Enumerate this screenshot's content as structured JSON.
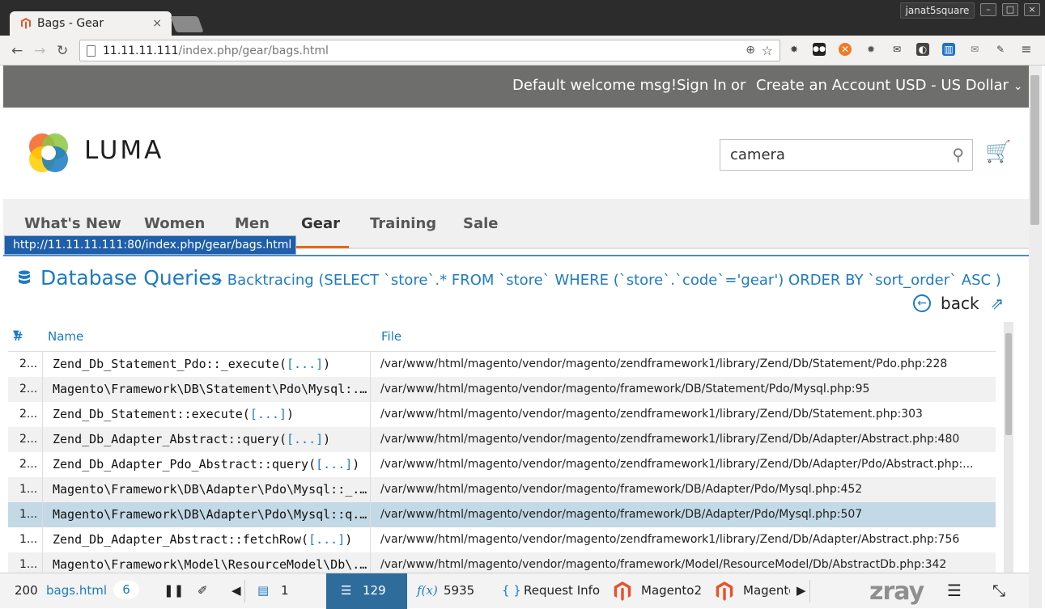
{
  "browser": {
    "tab_title": "Bags - Gear",
    "tab_close": "×",
    "user": "janat5square",
    "win_min": "–",
    "win_max": "□",
    "win_close": "×",
    "url_host": "11.11.11.111",
    "url_path": "/index.php/gear/bags.html",
    "status_url": "http://11.11.11.111:80/index.php/gear/bags.html"
  },
  "topbar": {
    "welcome": "Default welcome msg!",
    "sign_in": "Sign In",
    "or": "or",
    "create_account": "Create an Account",
    "currency": "USD - US Dollar"
  },
  "header": {
    "logo_text": "LUMA",
    "search_value": "camera"
  },
  "nav": {
    "items": [
      "What's New",
      "Women",
      "Men",
      "Gear",
      "Training",
      "Sale"
    ],
    "active": "Gear"
  },
  "panel": {
    "title": "Database Queries",
    "backtrace": "» Backtracing (SELECT `store`.* FROM `store` WHERE (`store`.`code`='gear') ORDER BY `sort_order` ASC )",
    "back_label": "back",
    "columns": {
      "num": "#",
      "name": "Name",
      "file": "File"
    },
    "rows": [
      {
        "num": "2...",
        "name": "Zend_Db_Statement_Pdo::_execute(",
        "args": "[...]",
        "close": ")",
        "file": "/var/www/html/magento/vendor/magento/zendframework1/library/Zend/Db/Statement/Pdo.php:228"
      },
      {
        "num": "2...",
        "name": "Magento\\Framework\\DB\\Statement\\Pdo\\Mysql:...",
        "args": "",
        "close": "",
        "file": "/var/www/html/magento/vendor/magento/framework/DB/Statement/Pdo/Mysql.php:95"
      },
      {
        "num": "2...",
        "name": "Zend_Db_Statement::execute(",
        "args": "[...]",
        "close": ")",
        "file": "/var/www/html/magento/vendor/magento/zendframework1/library/Zend/Db/Statement.php:303"
      },
      {
        "num": "2...",
        "name": "Zend_Db_Adapter_Abstract::query(",
        "args": "[...]",
        "close": ")",
        "file": "/var/www/html/magento/vendor/magento/zendframework1/library/Zend/Db/Adapter/Abstract.php:480"
      },
      {
        "num": "2...",
        "name": "Zend_Db_Adapter_Pdo_Abstract::query(",
        "args": "[...]",
        "close": ")",
        "file": "/var/www/html/magento/vendor/magento/zendframework1/library/Zend/Db/Adapter/Pdo/Abstract.php:..."
      },
      {
        "num": "1...",
        "name": "Magento\\Framework\\DB\\Adapter\\Pdo\\Mysql::_...",
        "args": "",
        "close": "",
        "file": "/var/www/html/magento/vendor/magento/framework/DB/Adapter/Pdo/Mysql.php:452"
      },
      {
        "num": "1...",
        "name": "Magento\\Framework\\DB\\Adapter\\Pdo\\Mysql::q...",
        "args": "",
        "close": "",
        "file": "/var/www/html/magento/vendor/magento/framework/DB/Adapter/Pdo/Mysql.php:507"
      },
      {
        "num": "1...",
        "name": "Zend_Db_Adapter_Abstract::fetchRow(",
        "args": "[...]",
        "close": ")",
        "file": "/var/www/html/magento/vendor/magento/zendframework1/library/Zend/Db/Adapter/Abstract.php:756"
      },
      {
        "num": "1...",
        "name": "Magento\\Framework\\Model\\ResourceModel\\Db\\...",
        "args": "",
        "close": "",
        "file": "/var/www/html/magento/vendor/magento/framework/Model/ResourceModel/Db/AbstractDb.php:342"
      }
    ],
    "selected_row": 6
  },
  "zray": {
    "status": "200",
    "page": "bags.html",
    "count": "6",
    "logs": "1",
    "db": "129",
    "functions": "5935",
    "request_info": "Request Info",
    "magento2": "Magento2",
    "magento_cut": "Magento",
    "logo": "zray",
    "fx": "f(x)",
    "braces": "{ }"
  },
  "colors": {
    "accent": "#1d7bc3",
    "nav_active": "#e36a19",
    "zray_active": "#2e6c9c"
  }
}
